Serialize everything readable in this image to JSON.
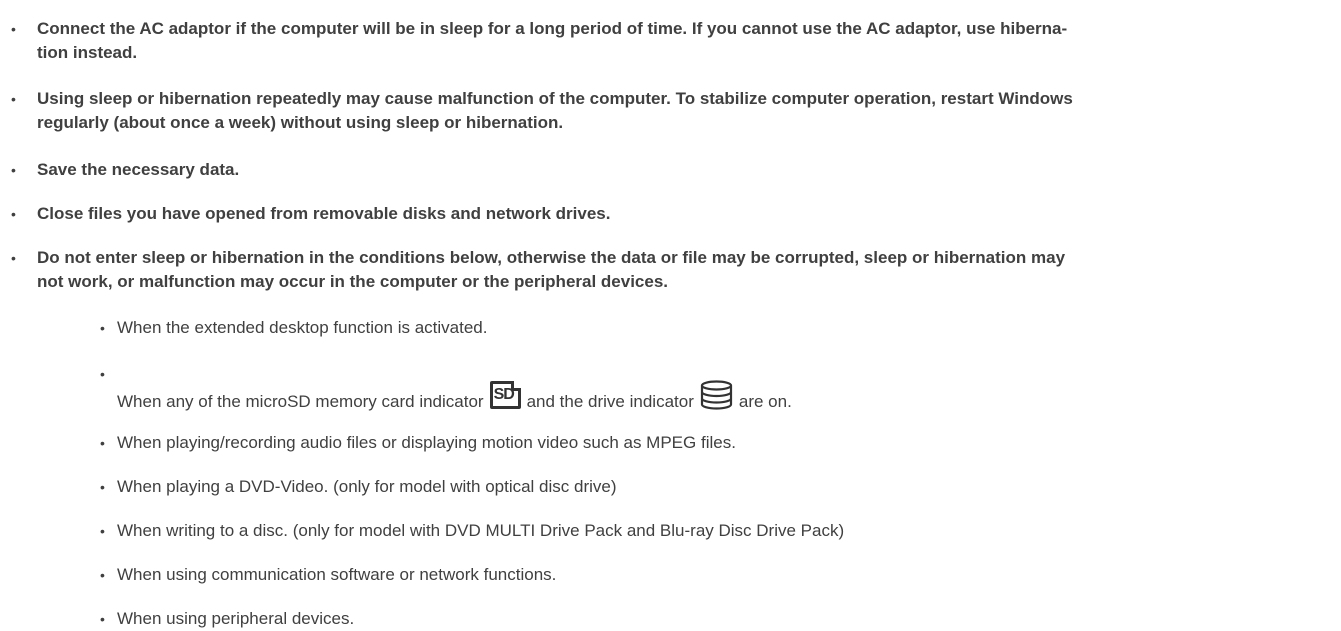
{
  "bold_items": [
    {
      "text": "Connect the AC adaptor if the computer will be in sleep for a long period of time. If you cannot use the AC adaptor, use hiberna-\ntion instead."
    },
    {
      "text": "Using sleep or hibernation repeatedly may cause malfunction of the computer. To stabilize computer operation, restart Windows\nregularly (about once a week) without using sleep or hibernation."
    },
    {
      "text": "Save the necessary data."
    },
    {
      "text": "Close files you have opened from removable disks and network drives."
    },
    {
      "text": "Do not enter sleep or hibernation in the conditions below, otherwise the data or file may be corrupted, sleep or hibernation may\nnot work, or malfunction may occur in the computer or the peripheral devices."
    }
  ],
  "sub_items": {
    "extended_desktop": "When the extended desktop function is activated.",
    "indicator_prefix": "When any of the microSD memory card indicator",
    "sd_icon_label": "SD",
    "indicator_middle": "and the drive indicator",
    "indicator_suffix": "are on.",
    "audio_video": "When playing/recording audio files or displaying motion video such as MPEG files.",
    "dvd_video": "When playing a DVD-Video. (only for model with optical disc drive)",
    "writing_disc": "When writing to a disc. (only for model with DVD MULTI Drive Pack and Blu-ray Disc Drive Pack)",
    "communication": "When using communication software or network functions.",
    "peripheral": "When using peripheral devices."
  },
  "icons": {
    "bullet": "•",
    "sd_indicator": "microsd-indicator-icon",
    "drive_indicator": "drive-indicator-icon"
  }
}
